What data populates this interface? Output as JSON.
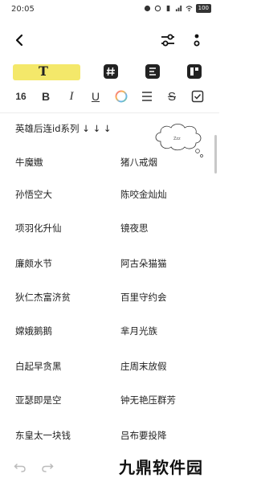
{
  "status_bar": {
    "time": "20:05",
    "battery": "100"
  },
  "toolbar": {
    "text_style_label": "T",
    "font_size": "16",
    "bold_label": "B",
    "italic_label": "I",
    "underline_label": "U",
    "strikethrough_label": "S",
    "highlight_color": "#f4e86a"
  },
  "note": {
    "heading": "英雄后连id系列 ↓ ↓ ↓",
    "doodle_text": "Zzz",
    "names": [
      {
        "left": "牛魔嫐",
        "right": "猪八戒烟"
      },
      {
        "left": "孙悟空大",
        "right": "陈咬金灿灿"
      },
      {
        "left": "项羽化升仙",
        "right": "镜夜思"
      },
      {
        "left": "廉颇水节",
        "right": "阿古朵猫猫"
      },
      {
        "left": "狄仁杰富济贫",
        "right": "百里守约会"
      },
      {
        "left": "嫦娥鹅鹅",
        "right": "芈月光族"
      },
      {
        "left": "白起早贪黑",
        "right": "庄周末放假"
      },
      {
        "left": "亚瑟即是空",
        "right": "钟无艳压群芳"
      },
      {
        "left": "东皇太一块钱",
        "right": "吕布要投降"
      }
    ]
  },
  "watermark": "九鼎软件园"
}
